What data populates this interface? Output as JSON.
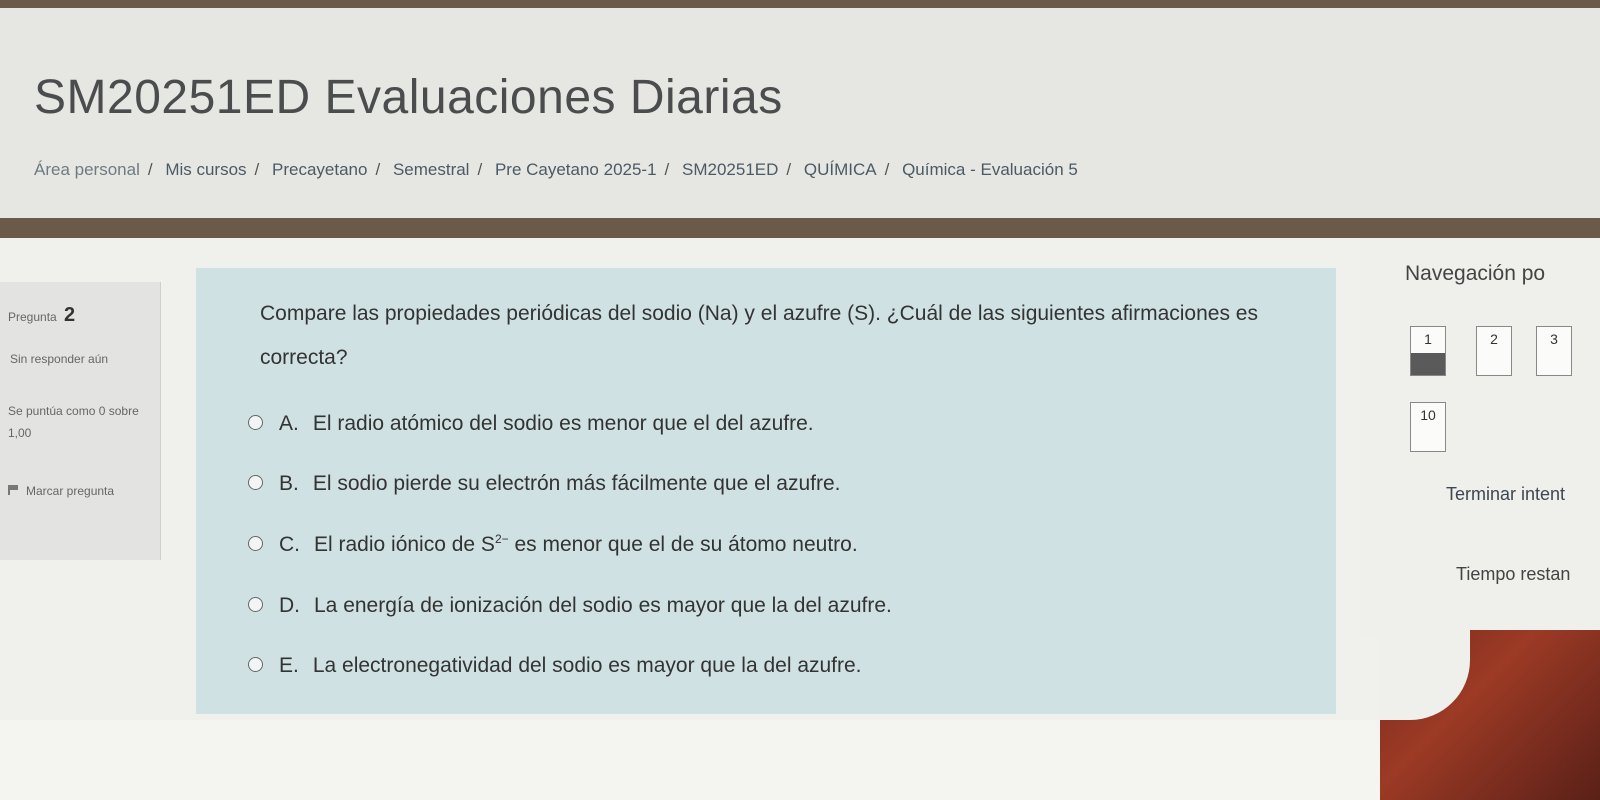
{
  "header": {
    "title": "SM20251ED Evaluaciones Diarias",
    "breadcrumb": [
      "Área personal",
      "Mis cursos",
      "Precayetano",
      "Semestral",
      "Pre Cayetano 2025-1",
      "SM20251ED",
      "QUÍMICA",
      "Química - Evaluación 5"
    ]
  },
  "question_info": {
    "label": "Pregunta",
    "number": "2",
    "state": "Sin responder aún",
    "grade": "Se puntúa como 0 sobre 1,00",
    "flag": "Marcar pregunta"
  },
  "question": {
    "text": "Compare las propiedades periódicas del sodio (Na) y el azufre (S). ¿Cuál de las siguientes afirmaciones es correcta?",
    "options": [
      {
        "letter": "A.",
        "text": "El radio atómico del sodio es menor que el del azufre."
      },
      {
        "letter": "B.",
        "text": "El sodio pierde su electrón más fácilmente que el azufre."
      },
      {
        "letter": "C.",
        "text_before": "El radio iónico de S",
        "sup": "2−",
        "text_after": " es menor que el de su átomo neutro."
      },
      {
        "letter": "D.",
        "text": "La energía de ionización del sodio es mayor que la del azufre."
      },
      {
        "letter": "E.",
        "text": "La electronegatividad del sodio es mayor que la del azufre."
      }
    ]
  },
  "navigation": {
    "title": "Navegación po",
    "buttons": [
      {
        "label": "1",
        "answered": true
      },
      {
        "label": "2",
        "answered": false
      },
      {
        "label": "3",
        "answered": false
      },
      {
        "label": "10",
        "answered": false
      }
    ],
    "finish_link": "Terminar intent",
    "timer_label": "Tiempo restan"
  },
  "colors": {
    "question_panel": "#cfe1e2",
    "answered_fill": "#5a5a5a",
    "frame": "#6b5a4a"
  }
}
